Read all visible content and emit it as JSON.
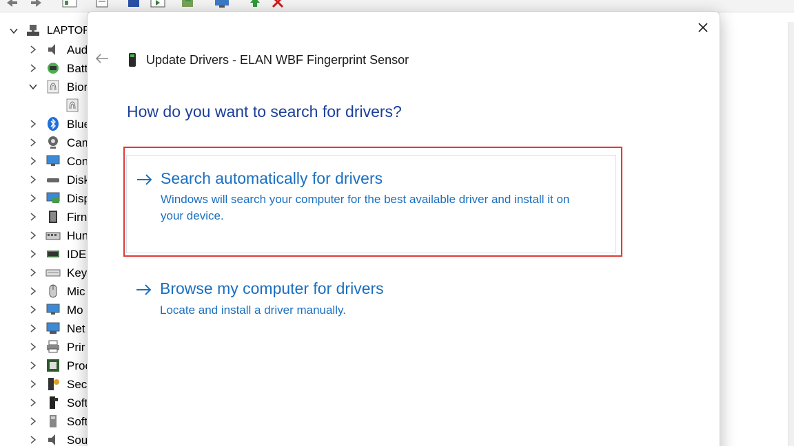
{
  "colors": {
    "question": "#1c3f99",
    "link": "#1a6fc0",
    "highlight": "#e03a34"
  },
  "tree": {
    "root": "LAPTOP",
    "items": [
      {
        "label": "Aud",
        "icon": "speaker-icon"
      },
      {
        "label": "Batt",
        "icon": "battery-icon"
      },
      {
        "label": "Bior",
        "icon": "fingerprint-icon"
      },
      {
        "label": "",
        "icon": "fingerprint-device-icon"
      },
      {
        "label": "Blue",
        "icon": "bluetooth-icon"
      },
      {
        "label": "Cam",
        "icon": "camera-icon"
      },
      {
        "label": "Con",
        "icon": "monitor-icon"
      },
      {
        "label": "Disk",
        "icon": "disk-drive-icon"
      },
      {
        "label": "Disp",
        "icon": "display-adapter-icon"
      },
      {
        "label": "Firn",
        "icon": "firmware-icon"
      },
      {
        "label": "Hun",
        "icon": "keyboard-hid-icon"
      },
      {
        "label": "IDE",
        "icon": "ide-controller-icon"
      },
      {
        "label": "Key",
        "icon": "keyboard-icon"
      },
      {
        "label": "Mic",
        "icon": "mouse-icon"
      },
      {
        "label": "Mo",
        "icon": "monitor-icon"
      },
      {
        "label": "Net",
        "icon": "network-icon"
      },
      {
        "label": "Prir",
        "icon": "printer-icon"
      },
      {
        "label": "Proc",
        "icon": "processor-icon"
      },
      {
        "label": "Secu",
        "icon": "security-icon"
      },
      {
        "label": "Soft",
        "icon": "software-component-icon"
      },
      {
        "label": "Soft",
        "icon": "software-device-icon"
      },
      {
        "label": "Sou",
        "icon": "speaker-icon"
      }
    ]
  },
  "dialog": {
    "title": "Update Drivers - ELAN WBF Fingerprint Sensor",
    "question": "How do you want to search for drivers?",
    "option_auto": {
      "title": "Search automatically for drivers",
      "desc_line1": "Windows will search your computer for the best available driver and install it on",
      "desc_line2": "your device."
    },
    "option_browse": {
      "title": "Browse my computer for drivers",
      "desc": "Locate and install a driver manually."
    }
  }
}
